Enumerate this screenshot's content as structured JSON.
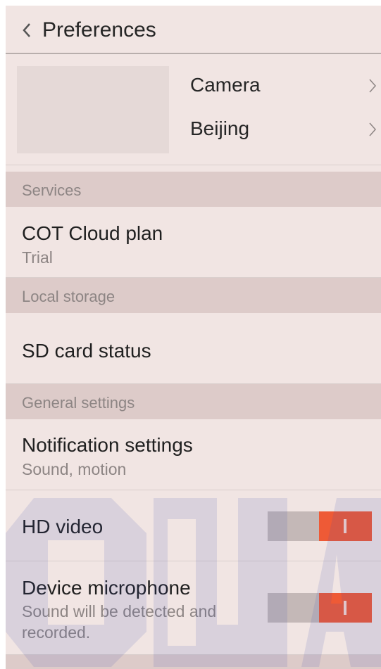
{
  "header": {
    "title": "Preferences",
    "back_icon": "chevron-left-icon"
  },
  "device": {
    "camera_label": "Camera",
    "location_label": "Beijing",
    "chevron_icon": "chevron-right-icon"
  },
  "sections": {
    "services": "Services",
    "local_storage": "Local storage",
    "general_settings": "General settings"
  },
  "rows": {
    "cloud_plan": {
      "title": "COT Cloud plan",
      "subtitle": "Trial"
    },
    "sd_card": {
      "title": "SD card status"
    },
    "notification": {
      "title": "Notification settings",
      "subtitle": "Sound, motion"
    },
    "hd_video": {
      "title": "HD video",
      "toggle_on": true
    },
    "microphone": {
      "title": "Device microphone",
      "subtitle_line1": "Sound will be detected and",
      "subtitle_line2": "recorded.",
      "toggle_on": true
    }
  },
  "colors": {
    "background": "#f1e5e3",
    "section_background": "#ddcbc9",
    "toggle_on": "#ee5a36",
    "toggle_track": "#c4b8b7",
    "watermark": "#3a4bb0"
  }
}
